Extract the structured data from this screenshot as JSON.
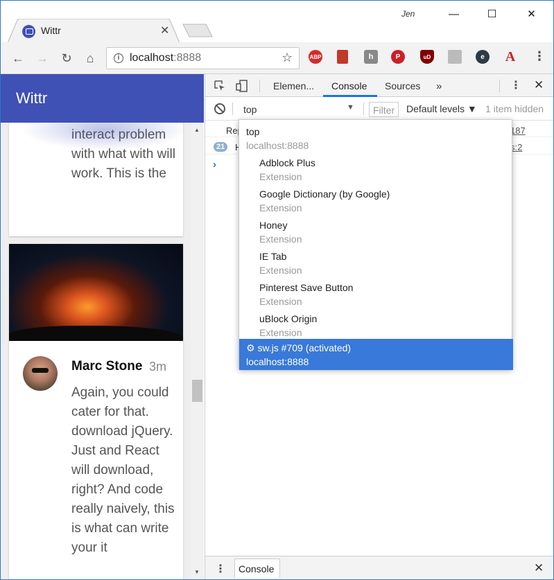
{
  "window": {
    "user": "Jen",
    "minimize_glyph": "—",
    "maximize_glyph": "☐",
    "close_glyph": "✕"
  },
  "tab": {
    "title": "Wittr",
    "close_glyph": "✕"
  },
  "toolbar": {
    "back_glyph": "←",
    "forward_glyph": "→",
    "reload_glyph": "↻",
    "home_glyph": "⌂",
    "url_host": "localhost",
    "url_port": ":8888",
    "star_glyph": "☆",
    "menu_glyph": "⋮",
    "extensions": [
      {
        "name": "adblock-plus-icon",
        "label": "ABP"
      },
      {
        "name": "google-dictionary-icon",
        "label": ""
      },
      {
        "name": "honey-icon",
        "label": "h"
      },
      {
        "name": "pinterest-icon",
        "label": "P"
      },
      {
        "name": "ublock-origin-icon",
        "label": "uD"
      },
      {
        "name": "ie-tab-icon",
        "label": ""
      },
      {
        "name": "chrome-extension-icon",
        "label": "e"
      },
      {
        "name": "acrobat-icon",
        "label": "A"
      }
    ]
  },
  "app": {
    "title": "Wittr",
    "colors": {
      "header": "#3f51b5"
    },
    "posts": [
      {
        "text": "interact problem with what with will work. This is the"
      },
      {
        "author": "Marc Stone",
        "time": "3m",
        "text": "Again, you could cater for that. download jQuery. Just and React will download, right? And code really naively, this is what can write your it"
      }
    ]
  },
  "devtools": {
    "tabs": [
      "Elemen...",
      "Console",
      "Sources"
    ],
    "more_glyph": "»",
    "menu_glyph": "⋮",
    "close_glyph": "✕",
    "active_tab": "Console",
    "context": "top",
    "context_caret": "▼",
    "filter_placeholder": "Filter",
    "levels": "Default levels ▼",
    "hidden": "1 item hidden",
    "messages": [
      {
        "text": "Rep",
        "source": "187"
      },
      {
        "count": "21",
        "text": "H",
        "source": "s:2"
      }
    ],
    "prompt_glyph": "›",
    "context_options": [
      {
        "title": "top",
        "subtitle": "localhost:8888",
        "kind": "top"
      },
      {
        "title": "Adblock Plus",
        "subtitle": "Extension",
        "kind": "ext"
      },
      {
        "title": "Google Dictionary (by Google)",
        "subtitle": "Extension",
        "kind": "ext"
      },
      {
        "title": "Honey",
        "subtitle": "Extension",
        "kind": "ext"
      },
      {
        "title": "IE Tab",
        "subtitle": "Extension",
        "kind": "ext"
      },
      {
        "title": "Pinterest Save Button",
        "subtitle": "Extension",
        "kind": "ext"
      },
      {
        "title": "uBlock Origin",
        "subtitle": "Extension",
        "kind": "ext"
      },
      {
        "title": "⚙ sw.js #709 (activated)",
        "subtitle": "localhost:8888",
        "kind": "selected"
      }
    ],
    "drawer": {
      "menu_glyph": "⋮",
      "tab": "Console",
      "close_glyph": "✕"
    },
    "colors": {
      "accent": "#1a73e8",
      "selected": "#3879d9"
    }
  }
}
